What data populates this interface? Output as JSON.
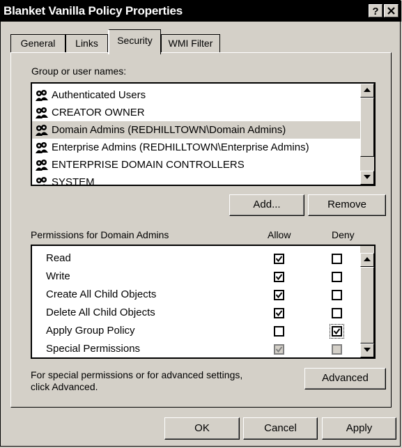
{
  "window": {
    "title": "Blanket Vanilla Policy Properties",
    "help_label": "?",
    "close_icon": "close-icon"
  },
  "tabs": [
    {
      "label": "General",
      "active": false
    },
    {
      "label": "Links",
      "active": false
    },
    {
      "label": "Security",
      "active": true
    },
    {
      "label": "WMI Filter",
      "active": false
    }
  ],
  "groups": {
    "label": "Group or user names:",
    "items": [
      {
        "name": "Authenticated Users",
        "selected": false
      },
      {
        "name": "CREATOR OWNER",
        "selected": false
      },
      {
        "name": "Domain Admins (REDHILLTOWN\\Domain Admins)",
        "selected": true
      },
      {
        "name": "Enterprise Admins (REDHILLTOWN\\Enterprise Admins)",
        "selected": false
      },
      {
        "name": "ENTERPRISE DOMAIN CONTROLLERS",
        "selected": false
      },
      {
        "name": "SYSTEM",
        "selected": false
      }
    ],
    "add_label": "Add...",
    "remove_label": "Remove"
  },
  "permissions": {
    "label": "Permissions for Domain Admins",
    "allow_label": "Allow",
    "deny_label": "Deny",
    "rows": [
      {
        "name": "Read",
        "allow": true,
        "deny": false,
        "disabled": false
      },
      {
        "name": "Write",
        "allow": true,
        "deny": false,
        "disabled": false
      },
      {
        "name": "Create All Child Objects",
        "allow": true,
        "deny": false,
        "disabled": false
      },
      {
        "name": "Delete All Child Objects",
        "allow": true,
        "deny": false,
        "disabled": false
      },
      {
        "name": "Apply Group Policy",
        "allow": false,
        "deny": true,
        "disabled": false
      },
      {
        "name": "Special Permissions",
        "allow": true,
        "deny": false,
        "disabled": true
      }
    ]
  },
  "advanced": {
    "text_line1": "For special permissions or for advanced settings,",
    "text_line2": "click Advanced.",
    "button_label": "Advanced"
  },
  "footer": {
    "ok_label": "OK",
    "cancel_label": "Cancel",
    "apply_label": "Apply"
  }
}
